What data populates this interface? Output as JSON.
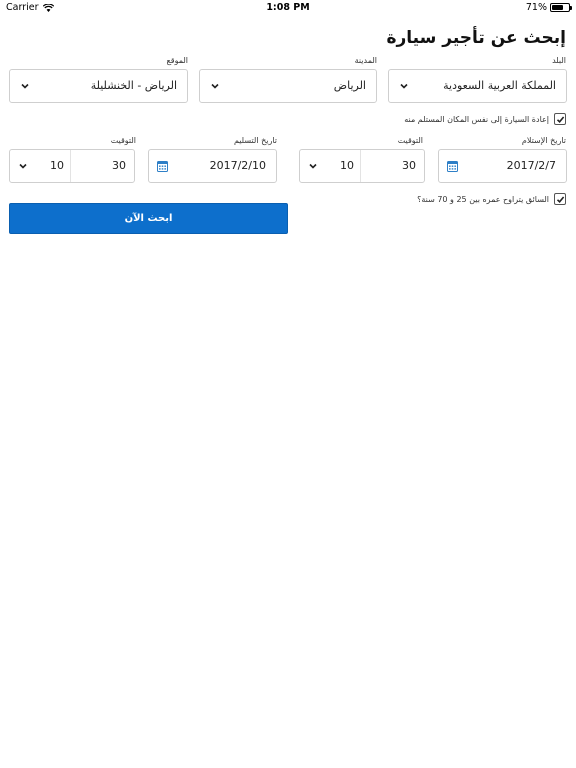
{
  "status": {
    "carrier": "Carrier",
    "time": "1:08 PM",
    "battery": "71%",
    "battery_level": 0.71
  },
  "title": "إبحث عن تأجير سيارة",
  "country": {
    "label": "البلد",
    "value": "المملكة العربية السعودية"
  },
  "city": {
    "label": "المدينة",
    "value": "الرياض"
  },
  "location": {
    "label": "الموقع",
    "value": "الرياض - الخنشليلة"
  },
  "return_same": {
    "label": "إعادة السيارة إلى نفس المكان المستلم منه",
    "checked": true
  },
  "pickup_date": {
    "label": "تاريخ الإستلام",
    "value": "2017/2/7"
  },
  "pickup_time": {
    "label": "التوقيت",
    "hour": "10",
    "minute": "30"
  },
  "dropoff_date": {
    "label": "تاريخ التسليم",
    "value": "2017/2/10"
  },
  "dropoff_time": {
    "label": "التوقيت",
    "hour": "10",
    "minute": "30"
  },
  "driver_age": {
    "label": "السائق يتراوح عمره بين 25 و 70 سنة؟",
    "checked": true
  },
  "search_button": "ابحث الآن",
  "colors": {
    "accent": "#0d6fcc",
    "border": "#cfcfcf",
    "calendar_icon": "#2e7fc7"
  }
}
